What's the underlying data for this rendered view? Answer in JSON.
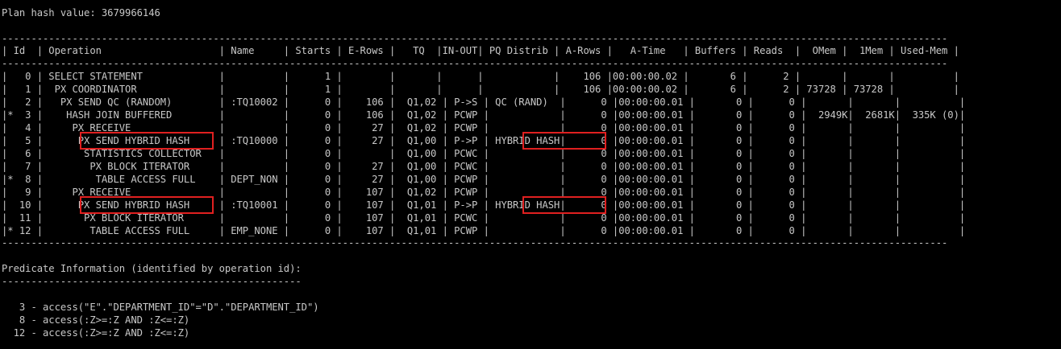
{
  "window": {
    "type": "terminal",
    "background": "#000000",
    "text_color": "#c8c8c8",
    "highlight_color": "#e02020"
  },
  "plan_hash": "Plan hash value: 3679966146",
  "separator": "-----------------------------------------------------------------------------------------------------------------------------------------------------------------",
  "header": "| Id  | Operation                    | Name     | Starts | E-Rows |   TQ  |IN-OUT| PQ Distrib | A-Rows |   A-Time   | Buffers | Reads  |  OMem |  1Mem | Used-Mem |",
  "rows": [
    "|   0 | SELECT STATEMENT             |          |      1 |        |       |      |            |    106 |00:00:00.02 |       6 |      2 |       |       |          |",
    "|   1 |  PX COORDINATOR              |          |      1 |        |       |      |            |    106 |00:00:00.02 |       6 |      2 | 73728 | 73728 |          |",
    "|   2 |   PX SEND QC (RANDOM)        | :TQ10002 |      0 |    106 |  Q1,02 | P->S | QC (RAND)  |      0 |00:00:00.01 |       0 |      0 |       |       |          |",
    "|*  3 |    HASH JOIN BUFFERED        |          |      0 |    106 |  Q1,02 | PCWP |            |      0 |00:00:00.01 |       0 |      0 |  2949K|  2681K|  335K (0)|",
    "|   4 |     PX RECEIVE               |          |      0 |     27 |  Q1,02 | PCWP |            |      0 |00:00:00.01 |       0 |      0 |       |       |          |",
    "|   5 |      PX SEND HYBRID HASH     | :TQ10000 |      0 |     27 |  Q1,00 | P->P | HYBRID HASH|      0 |00:00:00.01 |       0 |      0 |       |       |          |",
    "|   6 |       STATISTICS COLLECTOR   |          |      0 |        |  Q1,00 | PCWC |            |      0 |00:00:00.01 |       0 |      0 |       |       |          |",
    "|   7 |        PX BLOCK ITERATOR     |          |      0 |     27 |  Q1,00 | PCWC |            |      0 |00:00:00.01 |       0 |      0 |       |       |          |",
    "|*  8 |         TABLE ACCESS FULL    | DEPT_NON |      0 |     27 |  Q1,00 | PCWP |            |      0 |00:00:00.01 |       0 |      0 |       |       |          |",
    "|   9 |     PX RECEIVE               |          |      0 |    107 |  Q1,02 | PCWP |            |      0 |00:00:00.01 |       0 |      0 |       |       |          |",
    "|  10 |      PX SEND HYBRID HASH     | :TQ10001 |      0 |    107 |  Q1,01 | P->P | HYBRID HASH|      0 |00:00:00.01 |       0 |      0 |       |       |          |",
    "|  11 |       PX BLOCK ITERATOR      |          |      0 |    107 |  Q1,01 | PCWC |            |      0 |00:00:00.01 |       0 |      0 |       |       |          |",
    "|* 12 |        TABLE ACCESS FULL     | EMP_NONE |      0 |    107 |  Q1,01 | PCWP |            |      0 |00:00:00.01 |       0 |      0 |       |       |          |"
  ],
  "predicate_title": "Predicate Information (identified by operation id):",
  "predicate_separator": "---------------------------------------------------",
  "predicates": [
    "   3 - access(\"E\".\"DEPARTMENT_ID\"=\"D\".\"DEPARTMENT_ID\")",
    "   8 - access(:Z>=:Z AND :Z<=:Z)",
    "  12 - access(:Z>=:Z AND :Z<=:Z)"
  ]
}
